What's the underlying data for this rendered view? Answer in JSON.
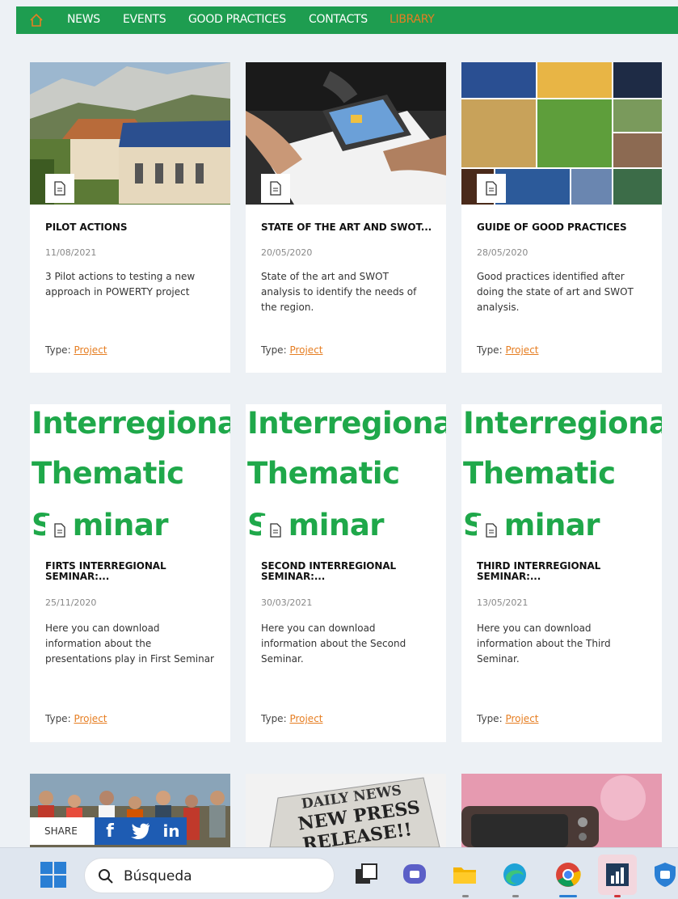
{
  "nav": {
    "home_icon": "home-icon",
    "items": [
      {
        "label": "NEWS"
      },
      {
        "label": "EVENTS"
      },
      {
        "label": "GOOD PRACTICES"
      },
      {
        "label": "CONTACTS"
      },
      {
        "label": "LIBRARY",
        "active": true
      }
    ],
    "bg_color": "#1e9d50",
    "active_color": "#e67e22"
  },
  "cards": [
    {
      "title": "PILOT ACTIONS",
      "date": "11/08/2021",
      "description": "3 Pilot actions to testing a new approach in POWERTY project",
      "type_label": "Type:",
      "type_link": "Project",
      "image": "houses-with-solar-panels-and-cliff"
    },
    {
      "title": "STATE OF THE ART AND SWOT...",
      "date": "20/05/2020",
      "description": "State of the art and SWOT analysis to identify the needs of the region.",
      "type_label": "Type:",
      "type_link": "Project",
      "image": "people-working-with-laptop-and-documents"
    },
    {
      "title": "GUIDE OF GOOD PRACTICES",
      "date": "28/05/2020",
      "description": "Good practices identified after doing the state of art and SWOT analysis.",
      "type_label": "Type:",
      "type_link": "Project",
      "image": "collage-of-solar-panels-and-fields"
    },
    {
      "title": "FIRTS INTERREGIONAL SEMINAR:...",
      "date": "25/11/2020",
      "description": "Here you can download information about the presentations play in First Seminar",
      "type_label": "Type:",
      "type_link": "Project",
      "poster": [
        "Interregiona",
        "Thematic",
        "Seminar"
      ]
    },
    {
      "title": "SECOND INTERREGIONAL SEMINAR:...",
      "date": "30/03/2021",
      "description": "Here you can download information about the Second Seminar.",
      "type_label": "Type:",
      "type_link": "Project",
      "poster": [
        "Interregiona",
        "Thematic",
        "Seminar"
      ]
    },
    {
      "title": "THIRD INTERREGIONAL SEMINAR:...",
      "date": "13/05/2021",
      "description": "Here you can download information about the Third Seminar.",
      "type_label": "Type:",
      "type_link": "Project",
      "poster": [
        "Interregiona",
        "Thematic",
        "Seminar"
      ]
    },
    {
      "image": "group-photo-of-people-outdoors"
    },
    {
      "image": "daily-news-new-press-release-newspaper",
      "image_text": [
        "DAILY NEWS",
        "NEW PRESS",
        "RELEASE!!"
      ]
    },
    {
      "image": "retro-tv-on-pink-background"
    }
  ],
  "share": {
    "label": "SHARE",
    "buttons": [
      {
        "icon": "facebook-icon",
        "glyph": "f"
      },
      {
        "icon": "twitter-icon",
        "glyph": "🐦"
      },
      {
        "icon": "linkedin-icon",
        "glyph": "in"
      }
    ],
    "color": "#1e5cb3"
  },
  "taskbar": {
    "search_placeholder": "Búsqueda",
    "apps": [
      "windows-start-icon",
      "search-icon",
      "task-view-icon",
      "chat-icon",
      "file-explorer-icon",
      "edge-icon",
      "chrome-icon",
      "power-bi-icon",
      "security-icon"
    ]
  }
}
